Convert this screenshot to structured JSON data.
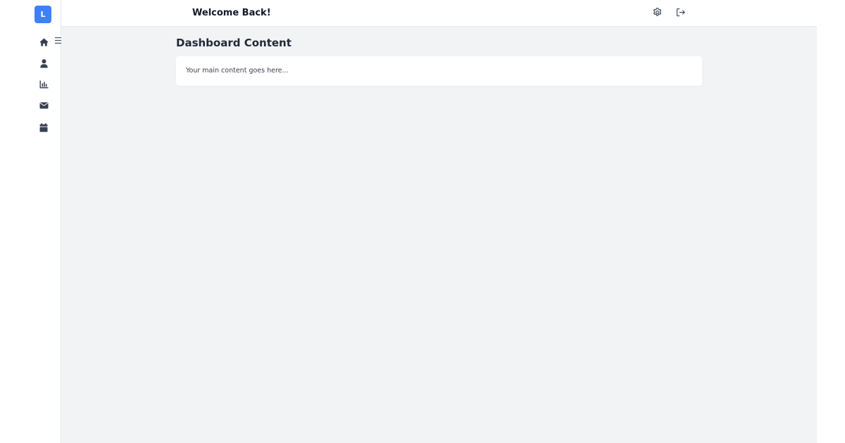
{
  "sidebar": {
    "logo_letter": "L",
    "toggle_icon": "menu-icon",
    "items": [
      {
        "icon": "home-icon"
      },
      {
        "icon": "user-icon"
      },
      {
        "icon": "chart-icon"
      },
      {
        "icon": "mail-icon"
      },
      {
        "icon": "calendar-icon"
      }
    ]
  },
  "header": {
    "title": "Welcome Back!",
    "actions": [
      {
        "icon": "gear-icon"
      },
      {
        "icon": "logout-icon"
      }
    ]
  },
  "main": {
    "title": "Dashboard Content",
    "card_text": "Your main content goes here..."
  },
  "colors": {
    "accent": "#3b82f6",
    "background": "#f2f3f5",
    "text": "#111827"
  }
}
